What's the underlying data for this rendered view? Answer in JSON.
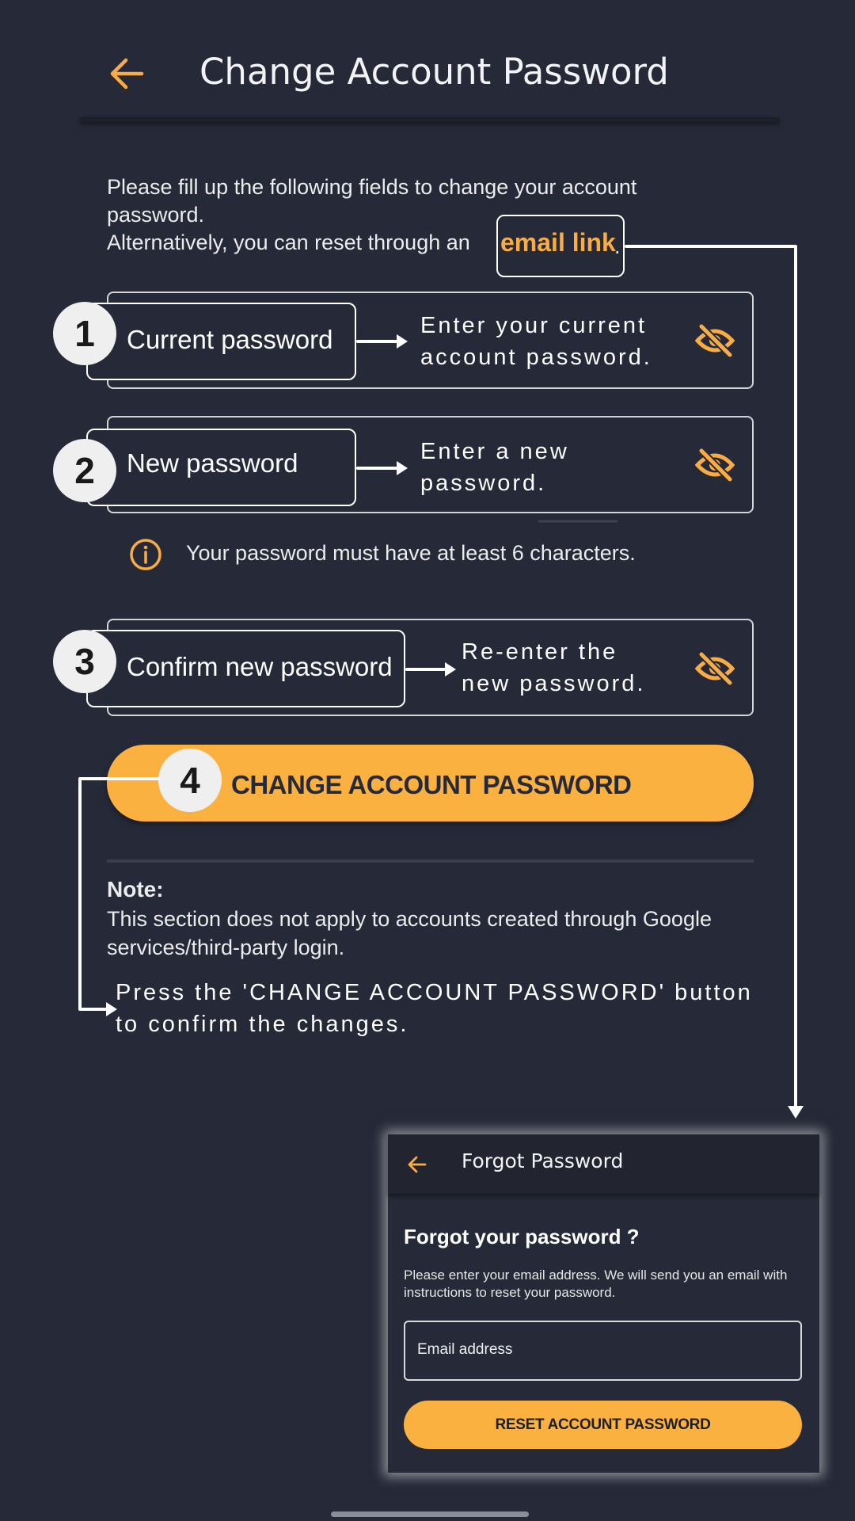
{
  "header": {
    "title": "Change Account Password",
    "back_icon": "arrow-left-icon"
  },
  "intro": {
    "line1": "Please fill up the following fields to change your account password.",
    "line2_prefix": "Alternatively, you can reset through an",
    "email_link": "email link",
    "line2_suffix": "."
  },
  "fields": [
    {
      "step": "1",
      "label": "Current password",
      "hint_line1": "Enter your current",
      "hint_line2": "account password.",
      "icon": "eye-off-icon"
    },
    {
      "step": "2",
      "label": "New password",
      "hint_line1": "Enter a new",
      "hint_line2": "password.",
      "icon": "eye-off-icon"
    },
    {
      "step": "3",
      "label": "Confirm new password",
      "hint_line1": "Re-enter the",
      "hint_line2": "new password.",
      "icon": "eye-off-icon"
    }
  ],
  "password_rule": "Your password must have at least 6 characters.",
  "change_button": {
    "step": "4",
    "label": "CHANGE ACCOUNT PASSWORD"
  },
  "note": {
    "title": "Note:",
    "text": "This section does not apply to accounts created through Google services/third-party login."
  },
  "instruction": {
    "line1": "Press the 'CHANGE ACCOUNT PASSWORD' button",
    "line2": "to confirm the changes."
  },
  "forgot_screen": {
    "title": "Forgot Password",
    "heading": "Forgot your password ?",
    "description": "Please enter your email address. We will send you an email with instructions to reset your password.",
    "email_placeholder": "Email address",
    "button_label": "RESET ACCOUNT PASSWORD"
  },
  "colors": {
    "background": "#262a38",
    "accent": "#fbb140",
    "text": "#ffffff"
  }
}
